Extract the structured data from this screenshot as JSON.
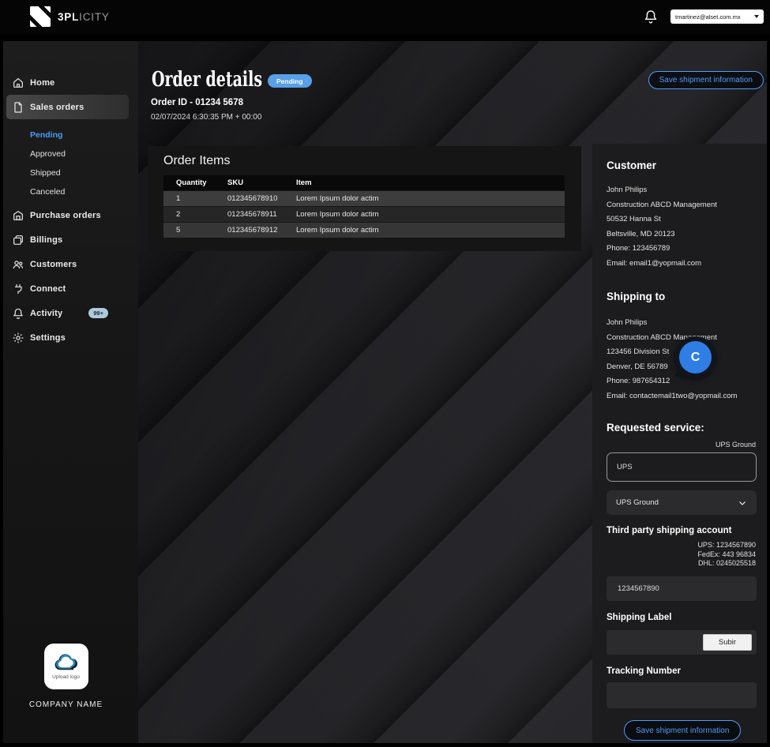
{
  "colors": {
    "accent": "#4f9cf7",
    "badge": "#58a0e8"
  },
  "topbar": {
    "brand_bold": "3PL",
    "brand_light": "ICITY",
    "account_email": "tmartinez@alset.com.mx"
  },
  "sidebar": {
    "items": [
      "Home",
      "Sales orders",
      "Purchase orders",
      "Billings",
      "Customers",
      "Connect",
      "Activity",
      "Settings"
    ],
    "sub_items": [
      "Pending",
      "Approved",
      "Shipped",
      "Canceled"
    ],
    "activity_badge": "99+",
    "upload_logo_label": "Upload logo",
    "company_name": "COMPANY NAME"
  },
  "header": {
    "title": "Order details",
    "status": "Pending",
    "order_id": "Order ID - 01234 5678",
    "timestamp": "02/07/2024 6:30:35 PM + 00:00",
    "save_button": "Save shipment information"
  },
  "order_items": {
    "title": "Order Items",
    "columns": [
      "Quantity",
      "SKU",
      "Item"
    ],
    "rows": [
      [
        "1",
        "012345678910",
        "Lorem Ipsum dolor actim"
      ],
      [
        "2",
        "012345678911",
        "Lorem Ipsum dolor actim"
      ],
      [
        "5",
        "012345678912",
        "Lorem Ipsum dolor actim"
      ]
    ]
  },
  "customer": {
    "heading": "Customer",
    "lines": [
      "John Philips",
      "Construction ABCD Management",
      "50532 Hanna St",
      "Beltsville, MD 20123",
      "Phone: 123456789",
      "Email: email1@yopmail.com"
    ]
  },
  "shipping_to": {
    "heading": "Shipping to",
    "lines": [
      "John Philips",
      "Construction ABCD Management",
      "123456 Division St",
      "Denver, DE 56789",
      "Phone: 987654312",
      "Email: contactemail1two@yopmail.com"
    ]
  },
  "collaborator": {
    "initial": "C"
  },
  "requested_service": {
    "heading": "Requested service:",
    "current": "UPS Ground",
    "carrier_value": "UPS",
    "service_value": "UPS Ground"
  },
  "third_party": {
    "heading": "Third party shipping account",
    "accounts": [
      "UPS: 1234567890",
      "FedEx: 443 96834",
      "DHL: 0245025518"
    ],
    "value": "1234567890"
  },
  "shipping_label": {
    "heading": "Shipping Label",
    "button": "Subir"
  },
  "tracking": {
    "heading": "Tracking Number",
    "value": ""
  },
  "footer": {
    "save_button": "Save shipment information"
  }
}
